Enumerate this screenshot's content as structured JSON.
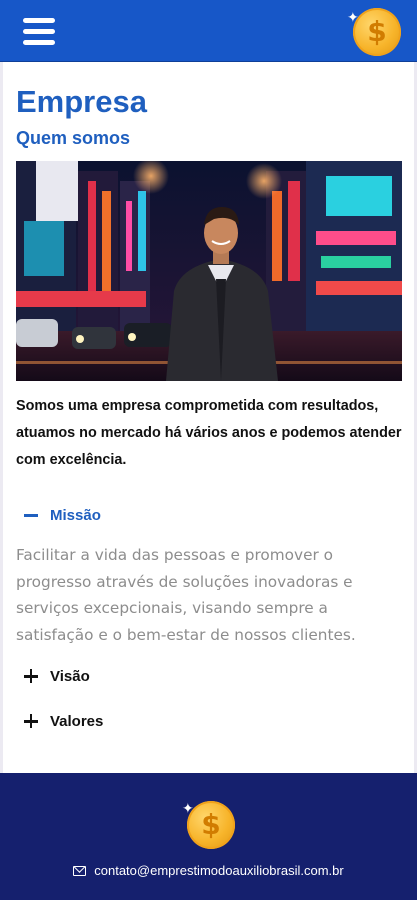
{
  "header": {
    "menu_icon": "hamburger-menu-icon",
    "logo_icon": "dollar-coin-icon",
    "logo_symbol": "$"
  },
  "main": {
    "title": "Empresa",
    "subtitle": "Quem somos",
    "hero_image": "smiling man in suit on neon-lit city street at night",
    "intro": "Somos uma empresa comprometida com resultados, atuamos no mercado há vários anos e podemos atender com excelência.",
    "accordion": [
      {
        "label": "Missão",
        "expanded": true,
        "icon": "minus-icon",
        "content": "Facilitar a vida das pessoas e promover o progresso através de soluções inovadoras e serviços excepcionais, visando sempre a satisfação e o bem-estar de nossos clientes."
      },
      {
        "label": "Visão",
        "expanded": false,
        "icon": "plus-icon"
      },
      {
        "label": "Valores",
        "expanded": false,
        "icon": "plus-icon"
      }
    ]
  },
  "footer": {
    "logo_symbol": "$",
    "email_icon": "envelope-icon",
    "email": "contato@emprestimodoauxiliobrasil.com.br"
  },
  "colors": {
    "header_bg": "#1757c8",
    "accent": "#1f5fbf",
    "footer_bg": "#15206e",
    "coin": "#f7b42a"
  }
}
